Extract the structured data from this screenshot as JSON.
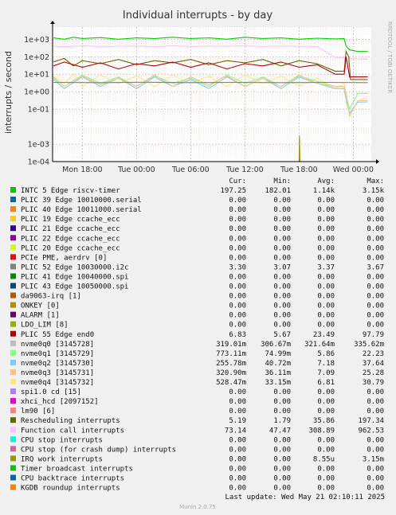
{
  "chart_data": {
    "type": "line",
    "title": "Individual interrupts - by day",
    "ylabel": "interrupts / second",
    "side_label": "RRDTOOL / TOBI OETIKER",
    "y_scale": "log",
    "ylim": [
      0.0001,
      5000
    ],
    "y_ticks": [
      "1e-04",
      "1e-03",
      "1e-01",
      "1e+00",
      "1e+01",
      "1e+02",
      "1e+03"
    ],
    "y_tick_values": [
      0.0001,
      0.001,
      0.1,
      1,
      10,
      100,
      1000
    ],
    "x_ticks": [
      "Mon 18:00",
      "Tue 00:00",
      "Tue 06:00",
      "Tue 12:00",
      "Tue 18:00",
      "Wed 00:00"
    ],
    "x_tick_hours": [
      18,
      24,
      30,
      36,
      42,
      48
    ],
    "x_range_hours": [
      14.7,
      50
    ],
    "grid": true,
    "legend_position": "bottom",
    "legend_headers": [
      "Cur:",
      "Min:",
      "Avg:",
      "Max:"
    ],
    "legend": [
      {
        "label": "INTC   5 Edge      riscv-timer",
        "color": "#00cc00",
        "cur": "197.25",
        "min": "182.01",
        "avg": "1.14k",
        "max": "3.15k"
      },
      {
        "label": "PLIC  39 Edge      10010000.serial",
        "color": "#0066b3",
        "cur": "0.00",
        "min": "0.00",
        "avg": "0.00",
        "max": "0.00"
      },
      {
        "label": "PLIC  40 Edge      10011000.serial",
        "color": "#ff8000",
        "cur": "0.00",
        "min": "0.00",
        "avg": "0.00",
        "max": "0.00"
      },
      {
        "label": "PLIC  19 Edge      ccache_ecc",
        "color": "#ffcc00",
        "cur": "0.00",
        "min": "0.00",
        "avg": "0.00",
        "max": "0.00"
      },
      {
        "label": "PLIC  21 Edge      ccache_ecc",
        "color": "#330099",
        "cur": "0.00",
        "min": "0.00",
        "avg": "0.00",
        "max": "0.00"
      },
      {
        "label": "PLIC  22 Edge      ccache_ecc",
        "color": "#990099",
        "cur": "0.00",
        "min": "0.00",
        "avg": "0.00",
        "max": "0.00"
      },
      {
        "label": "PLIC  20 Edge      ccache_ecc",
        "color": "#ccff00",
        "cur": "0.00",
        "min": "0.00",
        "avg": "0.00",
        "max": "0.00"
      },
      {
        "label": "PCIe PME, aerdrv [0]",
        "color": "#ff0000",
        "cur": "0.00",
        "min": "0.00",
        "avg": "0.00",
        "max": "0.00"
      },
      {
        "label": "PLIC  52 Edge      10030000.i2c",
        "color": "#808080",
        "cur": "3.30",
        "min": "3.07",
        "avg": "3.37",
        "max": "3.67"
      },
      {
        "label": "PLIC  41 Edge      10040000.spi",
        "color": "#008f00",
        "cur": "0.00",
        "min": "0.00",
        "avg": "0.00",
        "max": "0.00"
      },
      {
        "label": "PLIC  43 Edge      10050000.spi",
        "color": "#00487d",
        "cur": "0.00",
        "min": "0.00",
        "avg": "0.00",
        "max": "0.00"
      },
      {
        "label": "da9063-irq [1]",
        "color": "#b35a00",
        "cur": "0.00",
        "min": "0.00",
        "avg": "0.00",
        "max": "0.00"
      },
      {
        "label": "ONKEY [0]",
        "color": "#b38f00",
        "cur": "0.00",
        "min": "0.00",
        "avg": "0.00",
        "max": "0.00"
      },
      {
        "label": "ALARM [1]",
        "color": "#6b006b",
        "cur": "0.00",
        "min": "0.00",
        "avg": "0.00",
        "max": "0.00"
      },
      {
        "label": "LDO_LIM [8]",
        "color": "#8fb300",
        "cur": "0.00",
        "min": "0.00",
        "avg": "0.00",
        "max": "0.00"
      },
      {
        "label": "PLIC  55 Edge      end0",
        "color": "#b30000",
        "cur": "6.83",
        "min": "5.67",
        "avg": "23.49",
        "max": "97.79"
      },
      {
        "label": "nvme0q0 [3145728]",
        "color": "#bebebe",
        "cur": "319.01m",
        "min": "306.67m",
        "avg": "321.64m",
        "max": "335.62m"
      },
      {
        "label": "nvme0q1 [3145729]",
        "color": "#80ff80",
        "cur": "773.11m",
        "min": "74.99m",
        "avg": "5.86",
        "max": "22.23"
      },
      {
        "label": "nvme0q2 [3145730]",
        "color": "#80c9ff",
        "cur": "255.78m",
        "min": "40.72m",
        "avg": "7.18",
        "max": "37.64"
      },
      {
        "label": "nvme0q3 [3145731]",
        "color": "#ffc080",
        "cur": "320.90m",
        "min": "36.11m",
        "avg": "7.09",
        "max": "25.28"
      },
      {
        "label": "nvme0q4 [3145732]",
        "color": "#ffe680",
        "cur": "528.47m",
        "min": "33.15m",
        "avg": "6.81",
        "max": "30.79"
      },
      {
        "label": "spi1.0 cd [15]",
        "color": "#aa80ff",
        "cur": "0.00",
        "min": "0.00",
        "avg": "0.00",
        "max": "0.00"
      },
      {
        "label": "xhci_hcd [2097152]",
        "color": "#ee00cc",
        "cur": "0.00",
        "min": "0.00",
        "avg": "0.00",
        "max": "0.00"
      },
      {
        "label": "lm90 [6]",
        "color": "#ff8080",
        "cur": "0.00",
        "min": "0.00",
        "avg": "0.00",
        "max": "0.00"
      },
      {
        "label": "Rescheduling interrupts",
        "color": "#666600",
        "cur": "5.19",
        "min": "1.79",
        "avg": "35.86",
        "max": "197.34"
      },
      {
        "label": "Function call interrupts",
        "color": "#ffbfff",
        "cur": "73.14",
        "min": "47.47",
        "avg": "308.89",
        "max": "962.53"
      },
      {
        "label": "CPU stop interrupts",
        "color": "#00ffcc",
        "cur": "0.00",
        "min": "0.00",
        "avg": "0.00",
        "max": "0.00"
      },
      {
        "label": "CPU stop (for crash dump) interrupts",
        "color": "#cc6699",
        "cur": "0.00",
        "min": "0.00",
        "avg": "0.00",
        "max": "0.00"
      },
      {
        "label": "IRQ work interrupts",
        "color": "#999900",
        "cur": "0.00",
        "min": "0.00",
        "avg": "8.55u",
        "max": "3.15m"
      },
      {
        "label": "Timer broadcast interrupts",
        "color": "#00cc00",
        "cur": "0.00",
        "min": "0.00",
        "avg": "0.00",
        "max": "0.00"
      },
      {
        "label": "CPU backtrace interrupts",
        "color": "#0066b3",
        "cur": "0.00",
        "min": "0.00",
        "avg": "0.00",
        "max": "0.00"
      },
      {
        "label": "KGDB roundup interrupts",
        "color": "#ff8000",
        "cur": "0.00",
        "min": "0.00",
        "avg": "0.00",
        "max": "0.00"
      }
    ],
    "series": [
      {
        "legend_index": 0,
        "color": "#00cc00",
        "points": [
          [
            14.8,
            1200
          ],
          [
            16,
            1000
          ],
          [
            17,
            1300
          ],
          [
            18,
            1100
          ],
          [
            20,
            1250
          ],
          [
            22,
            1000
          ],
          [
            24,
            1200
          ],
          [
            26,
            1100
          ],
          [
            28,
            1300
          ],
          [
            30,
            1100
          ],
          [
            32,
            1200
          ],
          [
            34,
            1000
          ],
          [
            36,
            1300
          ],
          [
            38,
            1100
          ],
          [
            40,
            1200
          ],
          [
            42,
            1000
          ],
          [
            44,
            1150
          ],
          [
            46,
            1050
          ],
          [
            47,
            1100
          ],
          [
            47.2,
            400
          ],
          [
            47.6,
            250
          ],
          [
            48.5,
            200
          ],
          [
            49.6,
            200
          ]
        ]
      },
      {
        "legend_index": 25,
        "color": "#ffbfff",
        "points": [
          [
            14.8,
            400
          ],
          [
            16,
            380
          ],
          [
            18,
            420
          ],
          [
            20,
            390
          ],
          [
            22,
            400
          ],
          [
            24,
            410
          ],
          [
            26,
            380
          ],
          [
            28,
            420
          ],
          [
            30,
            390
          ],
          [
            32,
            410
          ],
          [
            34,
            400
          ],
          [
            36,
            420
          ],
          [
            38,
            390
          ],
          [
            40,
            410
          ],
          [
            42,
            400
          ],
          [
            44,
            380
          ],
          [
            46,
            90
          ],
          [
            47,
            90
          ],
          [
            47.2,
            20
          ],
          [
            47.6,
            80
          ],
          [
            48.5,
            75
          ],
          [
            49.6,
            73
          ]
        ]
      },
      {
        "legend_index": 24,
        "color": "#666600",
        "points": [
          [
            14.8,
            50
          ],
          [
            16,
            80
          ],
          [
            17,
            30
          ],
          [
            18,
            60
          ],
          [
            20,
            40
          ],
          [
            22,
            70
          ],
          [
            24,
            35
          ],
          [
            26,
            60
          ],
          [
            28,
            45
          ],
          [
            30,
            70
          ],
          [
            32,
            35
          ],
          [
            34,
            60
          ],
          [
            36,
            45
          ],
          [
            38,
            70
          ],
          [
            40,
            30
          ],
          [
            42,
            60
          ],
          [
            44,
            40
          ],
          [
            46,
            15
          ],
          [
            47,
            15
          ],
          [
            47.2,
            200
          ],
          [
            47.5,
            100
          ],
          [
            47.7,
            5
          ],
          [
            48.5,
            5
          ],
          [
            49.6,
            5
          ]
        ]
      },
      {
        "legend_index": 15,
        "color": "#b30000",
        "points": [
          [
            14.8,
            30
          ],
          [
            16,
            50
          ],
          [
            18,
            25
          ],
          [
            20,
            45
          ],
          [
            22,
            20
          ],
          [
            24,
            40
          ],
          [
            26,
            30
          ],
          [
            28,
            50
          ],
          [
            30,
            25
          ],
          [
            32,
            45
          ],
          [
            34,
            20
          ],
          [
            36,
            40
          ],
          [
            38,
            30
          ],
          [
            40,
            50
          ],
          [
            42,
            25
          ],
          [
            44,
            35
          ],
          [
            46,
            10
          ],
          [
            47,
            10
          ],
          [
            47.2,
            100
          ],
          [
            47.6,
            7
          ],
          [
            48.5,
            7
          ],
          [
            49.6,
            7
          ]
        ]
      },
      {
        "legend_index": 20,
        "color": "#ffe680",
        "points": [
          [
            14.8,
            8
          ],
          [
            16,
            3
          ],
          [
            17,
            10
          ],
          [
            18,
            2
          ],
          [
            20,
            9
          ],
          [
            22,
            3
          ],
          [
            24,
            8
          ],
          [
            26,
            2
          ],
          [
            28,
            9
          ],
          [
            30,
            3
          ],
          [
            32,
            8
          ],
          [
            34,
            2
          ],
          [
            36,
            9
          ],
          [
            38,
            3
          ],
          [
            40,
            8
          ],
          [
            42,
            2
          ],
          [
            44,
            6
          ],
          [
            46,
            1.5
          ],
          [
            47,
            3
          ],
          [
            47.3,
            0.5
          ],
          [
            47.6,
            0.05
          ],
          [
            48.5,
            0.3
          ],
          [
            49.6,
            0.5
          ]
        ]
      },
      {
        "legend_index": 17,
        "color": "#80ff80",
        "points": [
          [
            14.8,
            6
          ],
          [
            16,
            2
          ],
          [
            18,
            9
          ],
          [
            20,
            3
          ],
          [
            22,
            7
          ],
          [
            24,
            2
          ],
          [
            26,
            8
          ],
          [
            28,
            3
          ],
          [
            30,
            6
          ],
          [
            32,
            2
          ],
          [
            34,
            9
          ],
          [
            36,
            3
          ],
          [
            38,
            7
          ],
          [
            40,
            2
          ],
          [
            42,
            8
          ],
          [
            44,
            4
          ],
          [
            46,
            2
          ],
          [
            47,
            2
          ],
          [
            47.3,
            0.4
          ],
          [
            47.6,
            0.1
          ],
          [
            48.5,
            0.8
          ],
          [
            49.6,
            0.8
          ]
        ]
      },
      {
        "legend_index": 18,
        "color": "#80c9ff",
        "points": [
          [
            14.8,
            5
          ],
          [
            16,
            1.5
          ],
          [
            18,
            7
          ],
          [
            20,
            2
          ],
          [
            22,
            6
          ],
          [
            24,
            1.5
          ],
          [
            26,
            7
          ],
          [
            28,
            2
          ],
          [
            30,
            5
          ],
          [
            32,
            1.5
          ],
          [
            34,
            7
          ],
          [
            36,
            2
          ],
          [
            38,
            6
          ],
          [
            40,
            1.5
          ],
          [
            42,
            7
          ],
          [
            44,
            3
          ],
          [
            46,
            1.5
          ],
          [
            47,
            1.5
          ],
          [
            47.3,
            0.2
          ],
          [
            47.6,
            0.06
          ],
          [
            48.5,
            0.25
          ],
          [
            49.6,
            0.26
          ]
        ]
      },
      {
        "legend_index": 19,
        "color": "#ffc080",
        "points": [
          [
            14.8,
            7
          ],
          [
            16,
            2
          ],
          [
            18,
            8
          ],
          [
            20,
            2.5
          ],
          [
            22,
            6
          ],
          [
            24,
            2
          ],
          [
            26,
            9
          ],
          [
            28,
            2
          ],
          [
            30,
            7
          ],
          [
            32,
            2.5
          ],
          [
            34,
            8
          ],
          [
            36,
            2
          ],
          [
            38,
            6
          ],
          [
            40,
            2
          ],
          [
            42,
            9
          ],
          [
            44,
            3
          ],
          [
            46,
            2
          ],
          [
            47,
            2
          ],
          [
            47.3,
            0.3
          ],
          [
            47.6,
            0.04
          ],
          [
            48.5,
            0.3
          ],
          [
            49.6,
            0.32
          ]
        ]
      },
      {
        "legend_index": 8,
        "color": "#808080",
        "points": [
          [
            14.8,
            3.4
          ],
          [
            20,
            3.3
          ],
          [
            25,
            3.5
          ],
          [
            30,
            3.3
          ],
          [
            35,
            3.4
          ],
          [
            40,
            3.3
          ],
          [
            45,
            3.4
          ],
          [
            49.6,
            3.3
          ]
        ]
      },
      {
        "legend_index": 28,
        "color": "#999900",
        "points": [
          [
            14.8,
            0.0001
          ],
          [
            42,
            0.0001
          ],
          [
            42.05,
            0.003
          ],
          [
            42.1,
            0.0001
          ],
          [
            49.6,
            0.0001
          ]
        ]
      }
    ]
  },
  "footer": {
    "last_update": "Last update: Wed May 21 02:10:11 2025",
    "munin": "Munin 2.0.75"
  }
}
